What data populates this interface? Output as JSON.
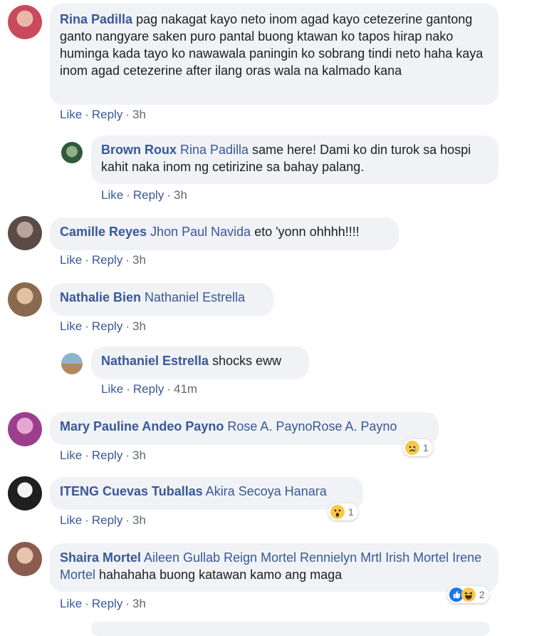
{
  "comments": [
    {
      "author": "Rina Padilla",
      "text": "pag nakagat kayo neto inom agad kayo cetezerine gantong ganto nangyare saken puro pantal buong ktawan ko tapos hirap nako huminga kada tayo ko nawawala paningin ko sobrang tindi neto haha kaya inom agad cetezerine after ilang oras wala na kalmado kana",
      "like": "Like",
      "reply": "Reply",
      "time": "3h",
      "avatar_color": "#c94a5c"
    },
    {
      "author": "Brown Roux",
      "tag": "Rina Padilla",
      "text": "same here! Dami ko din turok sa hospi kahit naka inom ng cetirizine sa bahay palang.",
      "like": "Like",
      "reply": "Reply",
      "time": "3h",
      "avatar_color": "#3f6b4a"
    },
    {
      "author": "Camille Reyes",
      "tag": "Jhon Paul Navida",
      "text": "eto 'yonn ohhhh!!!!",
      "like": "Like",
      "reply": "Reply",
      "time": "3h",
      "avatar_color": "#6b5a55"
    },
    {
      "author": "Nathalie Bien",
      "tag": "Nathaniel Estrella",
      "text": "",
      "like": "Like",
      "reply": "Reply",
      "time": "3h",
      "avatar_color": "#b08866"
    },
    {
      "author": "Nathaniel Estrella",
      "text": "shocks eww",
      "like": "Like",
      "reply": "Reply",
      "time": "41m",
      "avatar_color": "#6a8fa8"
    },
    {
      "author": "Mary Pauline Andeo Payno",
      "tag": "Rose A. PaynoRose A. Payno",
      "text": "",
      "like": "Like",
      "reply": "Reply",
      "time": "3h",
      "avatar_color": "#b04fa0",
      "reaction": {
        "icon": "sad-icon",
        "count": "1"
      }
    },
    {
      "author": "ITENG Cuevas Tuballas",
      "tag": "Akira Secoya Hanara",
      "text": "",
      "like": "Like",
      "reply": "Reply",
      "time": "3h",
      "avatar_color": "#3a3a3a",
      "reaction": {
        "icon": "wow-icon",
        "count": "1"
      }
    },
    {
      "author": "Shaira Mortel",
      "tag": "Aileen Gullab Reign Mortel Rennielyn Mrtl Irish Mortel Irene Mortel",
      "text": "hahahaha buong katawan kamo ang maga",
      "like": "Like",
      "reply": "Reply",
      "time": "3h",
      "avatar_color": "#9a6b5e",
      "reaction": {
        "icon": "like-haha-icon",
        "count": "2"
      }
    }
  ],
  "colors": {
    "link": "#385898",
    "bubble": "#f0f2f5",
    "meta": "#606770"
  }
}
